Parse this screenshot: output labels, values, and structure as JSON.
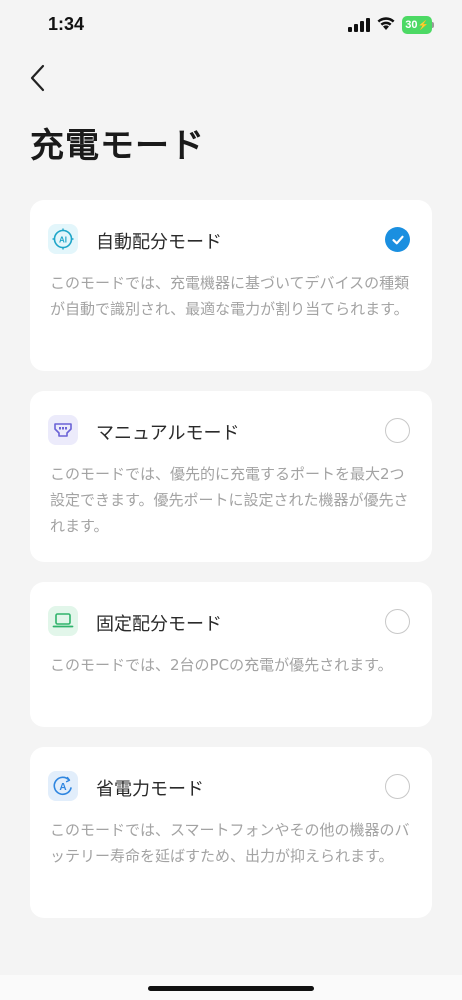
{
  "status_bar": {
    "time": "1:34",
    "battery": "30"
  },
  "header": {
    "title": "充電モード"
  },
  "modes": [
    {
      "title": "自動配分モード",
      "description": "このモードでは、充電機器に基づいてデバイスの種類が自動で識別され、最適な電力が割り当てられます。",
      "icon": "ai-icon",
      "icon_color": "#1fa6c9",
      "icon_bg": "#e3f6fb",
      "selected": true
    },
    {
      "title": "マニュアルモード",
      "description": "このモードでは、優先的に充電するポートを最大2つ設定できます。優先ポートに設定された機器が優先されます。",
      "icon": "port-icon",
      "icon_color": "#6b63d6",
      "icon_bg": "#ecebfb",
      "selected": false
    },
    {
      "title": "固定配分モード",
      "description": "このモードでは、2台のPCの充電が優先されます。",
      "icon": "laptop-icon",
      "icon_color": "#2fb36b",
      "icon_bg": "#e2f6ea",
      "selected": false
    },
    {
      "title": "省電力モード",
      "description": "このモードでは、スマートフォンやその他の機器のバッテリー寿命を延ばすため、出力が抑えられます。",
      "icon": "power-save-icon",
      "icon_color": "#2f86e0",
      "icon_bg": "#e2eefb",
      "selected": false
    }
  ],
  "colors": {
    "accent": "#1a8fe0",
    "background": "#f4f4f4",
    "card": "#ffffff",
    "description_text": "#a3a3a3"
  }
}
